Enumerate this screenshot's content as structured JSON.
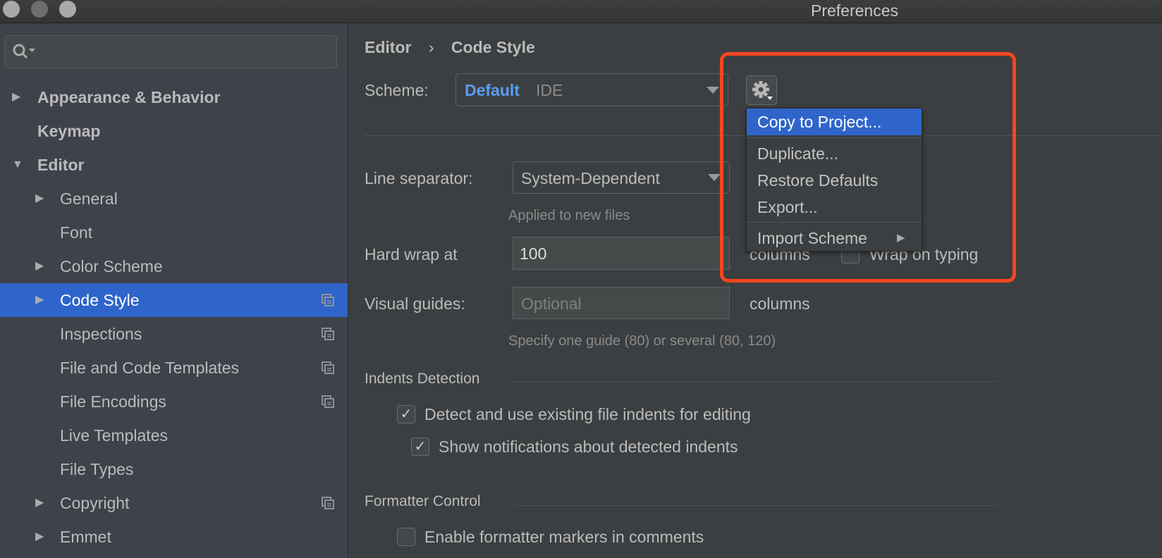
{
  "window": {
    "title": "Preferences"
  },
  "sidebar": {
    "search_placeholder": "",
    "items": [
      {
        "label": "Appearance & Behavior",
        "level": 0,
        "expandable": true,
        "expanded": false,
        "bold": true
      },
      {
        "label": "Keymap",
        "level": 0,
        "expandable": false,
        "bold": true
      },
      {
        "label": "Editor",
        "level": 0,
        "expandable": true,
        "expanded": true,
        "bold": true
      },
      {
        "label": "General",
        "level": 1,
        "expandable": true
      },
      {
        "label": "Font",
        "level": 1,
        "expandable": false
      },
      {
        "label": "Color Scheme",
        "level": 1,
        "expandable": true
      },
      {
        "label": "Code Style",
        "level": 1,
        "expandable": true,
        "selected": true,
        "project_icon": true
      },
      {
        "label": "Inspections",
        "level": 1,
        "project_icon": true
      },
      {
        "label": "File and Code Templates",
        "level": 1,
        "project_icon": true
      },
      {
        "label": "File Encodings",
        "level": 1,
        "project_icon": true
      },
      {
        "label": "Live Templates",
        "level": 1
      },
      {
        "label": "File Types",
        "level": 1
      },
      {
        "label": "Copyright",
        "level": 1,
        "expandable": true,
        "project_icon": true
      },
      {
        "label": "Emmet",
        "level": 1,
        "expandable": true
      }
    ]
  },
  "breadcrumb": {
    "parent": "Editor",
    "separator": "›",
    "current": "Code Style"
  },
  "scheme": {
    "label": "Scheme:",
    "name": "Default",
    "type": "IDE"
  },
  "gear_menu": {
    "items": [
      "Copy to Project...",
      "Duplicate...",
      "Restore Defaults",
      "Export...",
      "Import Scheme"
    ],
    "highlighted": "Copy to Project..."
  },
  "line_separator": {
    "label": "Line separator:",
    "value": "System-Dependent",
    "hint": "Applied to new files"
  },
  "hard_wrap": {
    "label": "Hard wrap at",
    "value": "100",
    "unit": "columns",
    "wrap_on_typing_label": "Wrap on typing",
    "wrap_on_typing": false
  },
  "visual_guides": {
    "label": "Visual guides:",
    "placeholder": "Optional",
    "unit": "columns",
    "hint": "Specify one guide (80) or several (80, 120)"
  },
  "indents_detection": {
    "title": "Indents Detection",
    "detect_label": "Detect and use existing file indents for editing",
    "detect": true,
    "notify_label": "Show notifications about detected indents",
    "notify": true
  },
  "formatter_control": {
    "title": "Formatter Control",
    "markers_label": "Enable formatter markers in comments",
    "markers": false
  },
  "colors": {
    "accent": "#2f65ca",
    "highlight_box": "#f5461f",
    "scheme_name": "#589df6"
  }
}
